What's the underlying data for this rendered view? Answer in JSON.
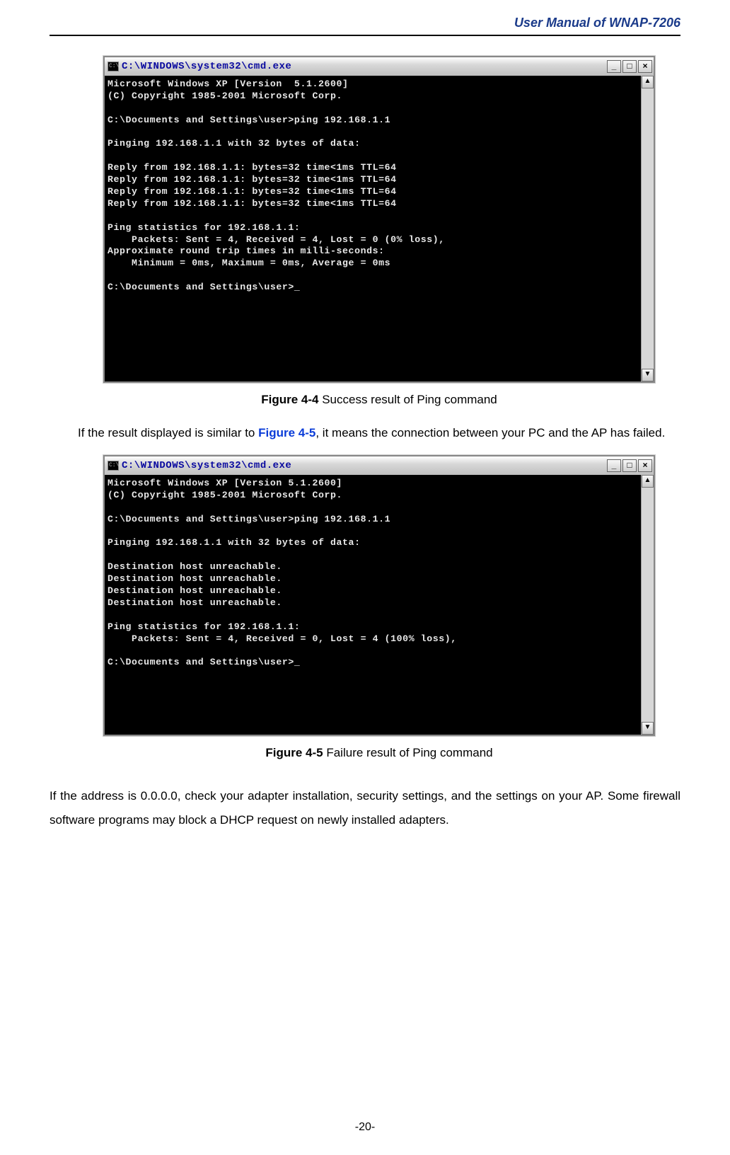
{
  "header": {
    "title": "User Manual of WNAP-7206"
  },
  "cmd_success": {
    "window_title": "C:\\WINDOWS\\system32\\cmd.exe",
    "buttons": {
      "min": "_",
      "max": "□",
      "close": "×"
    },
    "scroll": {
      "up": "▲",
      "down": "▼"
    },
    "output": "Microsoft Windows XP [Version  5.1.2600]\n(C) Copyright 1985-2001 Microsoft Corp.\n\nC:\\Documents and Settings\\user>ping 192.168.1.1\n\nPinging 192.168.1.1 with 32 bytes of data:\n\nReply from 192.168.1.1: bytes=32 time<1ms TTL=64\nReply from 192.168.1.1: bytes=32 time<1ms TTL=64\nReply from 192.168.1.1: bytes=32 time<1ms TTL=64\nReply from 192.168.1.1: bytes=32 time<1ms TTL=64\n\nPing statistics for 192.168.1.1:\n    Packets: Sent = 4, Received = 4, Lost = 0 (0% loss),\nApproximate round trip times in milli-seconds:\n    Minimum = 0ms, Maximum = 0ms, Average = 0ms\n\nC:\\Documents and Settings\\user>_"
  },
  "caption_success": {
    "label": "Figure 4-4",
    "text": " Success result of Ping command"
  },
  "para1": {
    "pre": "If the result displayed is similar to ",
    "link": "Figure 4-5",
    "post": ", it means the connection between your PC and the AP has failed."
  },
  "cmd_failure": {
    "window_title": "C:\\WINDOWS\\system32\\cmd.exe",
    "buttons": {
      "min": "_",
      "max": "□",
      "close": "×"
    },
    "scroll": {
      "up": "▲",
      "down": "▼"
    },
    "output": "Microsoft Windows XP [Version 5.1.2600]\n(C) Copyright 1985-2001 Microsoft Corp.\n\nC:\\Documents and Settings\\user>ping 192.168.1.1\n\nPinging 192.168.1.1 with 32 bytes of data:\n\nDestination host unreachable.\nDestination host unreachable.\nDestination host unreachable.\nDestination host unreachable.\n\nPing statistics for 192.168.1.1:\n    Packets: Sent = 4, Received = 0, Lost = 4 (100% loss),\n\nC:\\Documents and Settings\\user>_"
  },
  "caption_failure": {
    "label": "Figure 4-5",
    "text": " Failure result of Ping command"
  },
  "para2": "If the address is 0.0.0.0, check your adapter installation, security settings, and the settings on your AP. Some firewall software programs may block a DHCP request on newly installed adapters.",
  "page_number": "-20-"
}
